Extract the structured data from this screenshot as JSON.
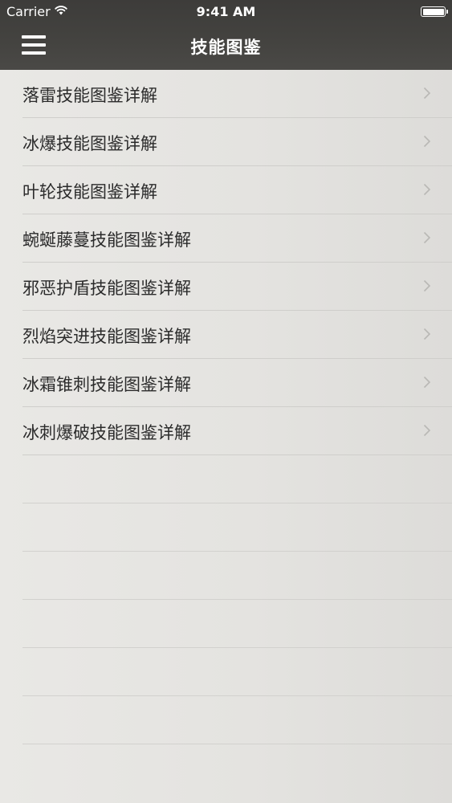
{
  "status_bar": {
    "carrier": "Carrier",
    "time": "9:41 AM"
  },
  "nav": {
    "title": "技能图鉴",
    "menu_icon": "hamburger-menu-icon"
  },
  "colors": {
    "header_bg": "#444340",
    "list_bg": "#e6e5e2",
    "separator": "#cfcecb",
    "text": "#2b2b2b",
    "chevron": "#b9b8b5"
  },
  "list": {
    "items": [
      {
        "label": "落雷技能图鉴详解"
      },
      {
        "label": "冰爆技能图鉴详解"
      },
      {
        "label": "叶轮技能图鉴详解"
      },
      {
        "label": "蜿蜒藤蔓技能图鉴详解"
      },
      {
        "label": "邪恶护盾技能图鉴详解"
      },
      {
        "label": "烈焰突进技能图鉴详解"
      },
      {
        "label": "冰霜锥刺技能图鉴详解"
      },
      {
        "label": "冰刺爆破技能图鉴详解"
      }
    ]
  }
}
